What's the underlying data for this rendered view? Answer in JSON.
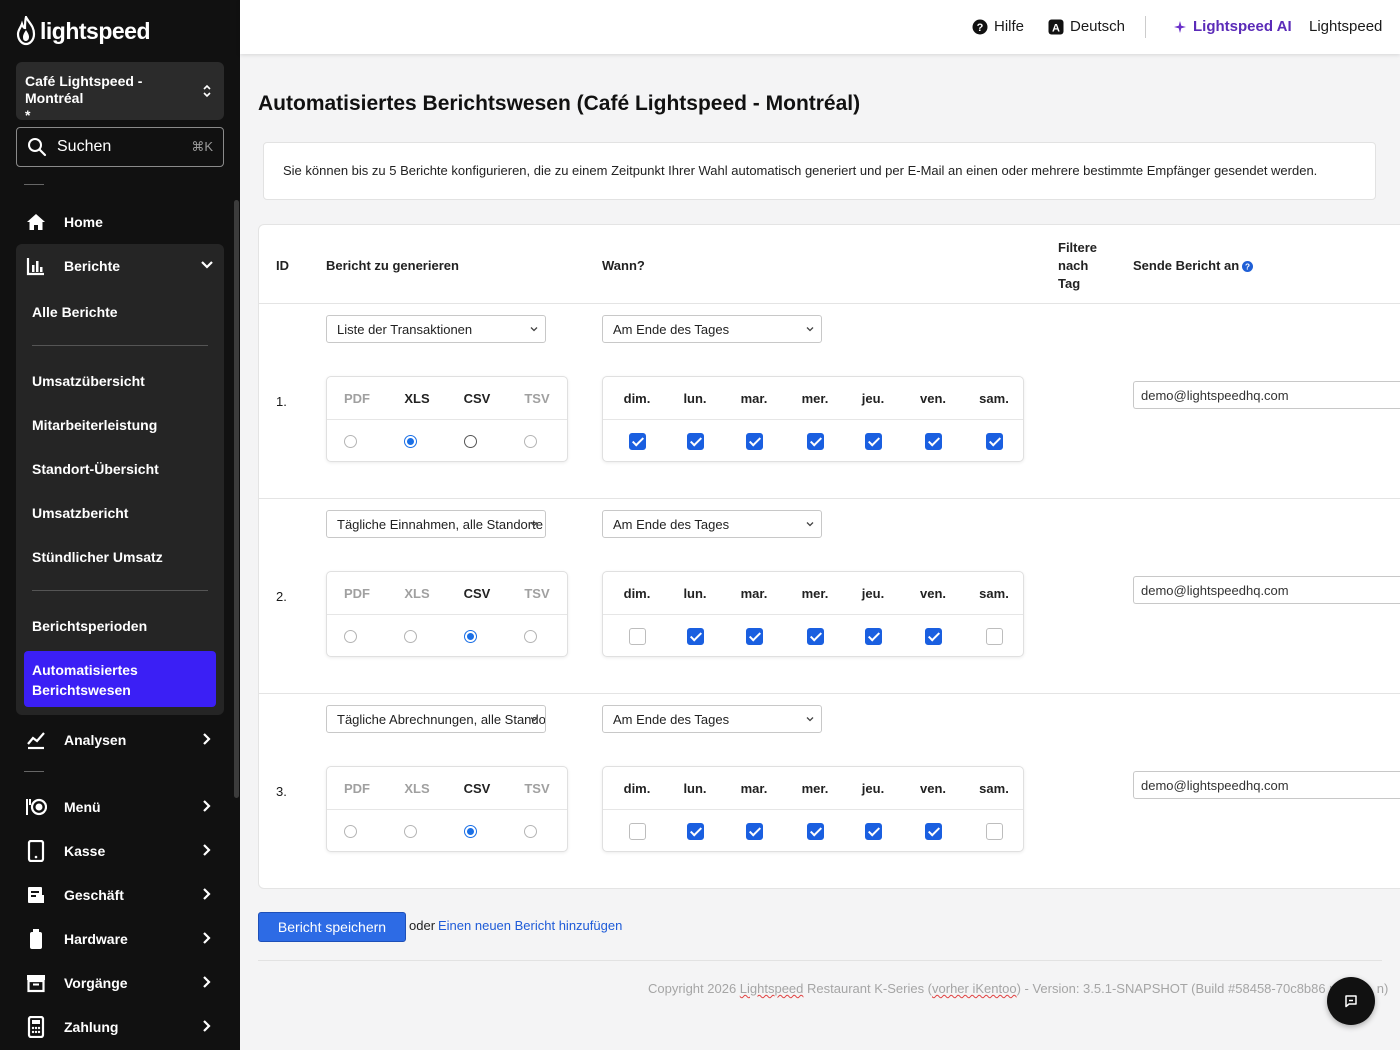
{
  "brand": {
    "name": "lightspeed",
    "accent": "#3b1ff5",
    "primary_blue": "#2d6be5"
  },
  "sidebar": {
    "store_name": "Café Lightspeed - Montréal",
    "store_sub": "*",
    "search": {
      "label": "Suchen",
      "shortcut": "⌘K"
    },
    "home": "Home",
    "reports": {
      "label": "Berichte",
      "items": [
        "Alle Berichte",
        "Umsatzübersicht",
        "Mitarbeiterleistung",
        "Standort-Übersicht",
        "Umsatzbericht",
        "Stündlicher Umsatz",
        "Berichtsperioden"
      ],
      "active_line1": "Automatisiertes",
      "active_line2": "Berichtswesen"
    },
    "nav": [
      "Analysen",
      "Menü",
      "Kasse",
      "Geschäft",
      "Hardware",
      "Vorgänge",
      "Zahlung"
    ]
  },
  "topbar": {
    "help": "Hilfe",
    "language": "Deutsch",
    "ai": "Lightspeed AI",
    "account": "Lightspeed"
  },
  "page": {
    "title": "Automatisiertes Berichtswesen (Café Lightspeed - Montréal)",
    "info": "Sie können bis zu 5 Berichte konfigurieren, die zu einem Zeitpunkt Ihrer Wahl automatisch generiert und per E-Mail an einen oder mehrere bestimmte Empfänger gesendet werden."
  },
  "table": {
    "headers": {
      "id": "ID",
      "report": "Bericht zu generieren",
      "when": "Wann?",
      "filter_line1": "Filtere",
      "filter_line2": "nach",
      "filter_line3": "Tag",
      "send": "Sende Bericht an"
    },
    "formats": [
      "PDF",
      "XLS",
      "CSV",
      "TSV"
    ],
    "days": [
      "dim.",
      "lun.",
      "mar.",
      "mer.",
      "jeu.",
      "ven.",
      "sam."
    ],
    "rows": [
      {
        "id": "1.",
        "report": "Liste der Transaktionen",
        "when": "Am Ende des Tages",
        "format": "XLS",
        "days": [
          true,
          true,
          true,
          true,
          true,
          true,
          true
        ],
        "email": "demo@lightspeedhq.com"
      },
      {
        "id": "2.",
        "report": "Tägliche Einnahmen, alle Standorte",
        "when": "Am Ende des Tages",
        "format": "CSV",
        "days": [
          false,
          true,
          true,
          true,
          true,
          true,
          false
        ],
        "email": "demo@lightspeedhq.com"
      },
      {
        "id": "3.",
        "report": "Tägliche Abrechnungen, alle Standorte",
        "when": "Am Ende des Tages",
        "format": "CSV",
        "days": [
          false,
          true,
          true,
          true,
          true,
          true,
          false
        ],
        "email": "demo@lightspeedhq.com"
      }
    ]
  },
  "actions": {
    "save": "Bericht speichern",
    "or": "oder",
    "add": "Einen neuen Bericht hinzufügen"
  },
  "footer": {
    "copyright_pre": "Copyright 2026 ",
    "copyright_brand": "Lightspeed",
    "copyright_mid": " Restaurant K-Series (",
    "copyright_prev": "vorher iKentoo",
    "copyright_post": ") - Version: 3.5.1-SNAPSHOT (Build #58458-70c8b86 pr",
    "copyright_tail": "n)"
  }
}
